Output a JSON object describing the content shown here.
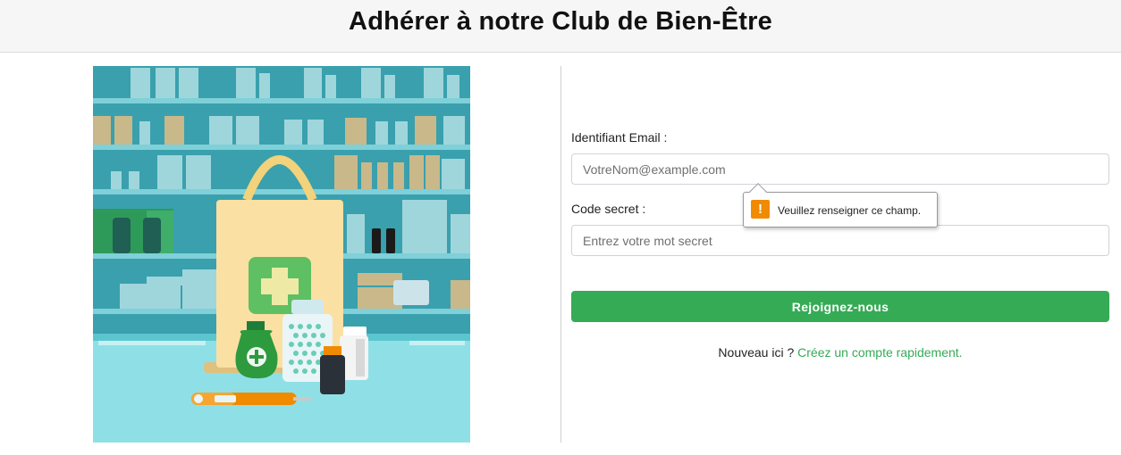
{
  "header": {
    "title": "Adhérer à notre Club de Bien-Être"
  },
  "form": {
    "email_label": "Identifiant Email :",
    "email_placeholder": "VotreNom@example.com",
    "password_label": "Code secret :",
    "password_placeholder": "Entrez votre mot secret",
    "submit_label": "Rejoignez-nous",
    "signup_prefix": "Nouveau ici ?",
    "signup_link": "Créez un compte rapidement."
  },
  "tooltip": {
    "message": "Veuillez renseigner ce champ.",
    "icon": "warning-icon"
  },
  "colors": {
    "accent": "#35ab55",
    "warning": "#f08a00",
    "header_bg": "#f6f6f6"
  }
}
